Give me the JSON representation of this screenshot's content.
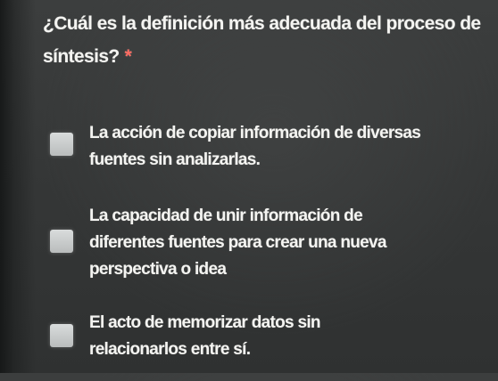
{
  "question": {
    "text": "¿Cuál es la definición más adecuada del proceso de síntesis?",
    "required_marker": "*"
  },
  "options": [
    {
      "label": "La acción de copiar información de diversas fuentes sin analizarlas."
    },
    {
      "label": "La capacidad de unir información de diferentes fuentes para crear una nueva perspectiva o idea"
    },
    {
      "label": "El acto de memorizar datos sin relacionarlos entre sí."
    }
  ],
  "colors": {
    "background": "#363838",
    "text": "#f4f4f1",
    "required": "#ff6b61",
    "radio": "#c9cccc"
  }
}
